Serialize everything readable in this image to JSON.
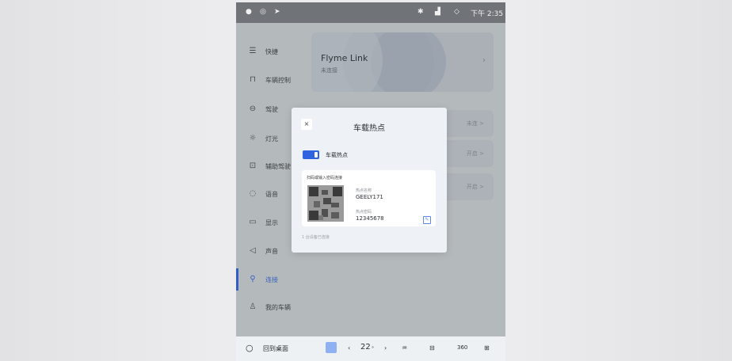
{
  "status_bar": {
    "left_icons": [
      "person-icon",
      "target-icon",
      "location-arrow-icon"
    ],
    "right_icons": [
      "bluetooth-icon",
      "signal-icon",
      "wifi-icon"
    ],
    "time": "下午 2:35"
  },
  "sidebar": {
    "items": [
      {
        "label": "快捷",
        "icon": "menu-icon"
      },
      {
        "label": "车辆控制",
        "icon": "car-icon"
      },
      {
        "label": "驾驶",
        "icon": "steering-wheel-icon"
      },
      {
        "label": "灯光",
        "icon": "light-icon"
      },
      {
        "label": "辅助驾驶",
        "icon": "assist-icon"
      },
      {
        "label": "语音",
        "icon": "voice-icon"
      },
      {
        "label": "显示",
        "icon": "display-icon"
      },
      {
        "label": "声音",
        "icon": "sound-icon"
      },
      {
        "label": "连接",
        "icon": "link-icon",
        "active": true
      },
      {
        "label": "我的车辆",
        "icon": "user-icon"
      }
    ]
  },
  "content": {
    "flyme": {
      "title": "Flyme Link",
      "subtitle": "未连接"
    },
    "rows": [
      {
        "tag": "未连 >"
      },
      {
        "tag": "开启 >"
      },
      {
        "tag": "开启 >"
      }
    ]
  },
  "modal": {
    "close_glyph": "×",
    "title": "车载热点",
    "toggle_label": "车载热点",
    "toggle_on": true,
    "scan_hint": "扫码或输入密码连接",
    "name_label": "热点名称",
    "name_value": "GEELY171",
    "password_label": "热点密码",
    "password_value": "12345678",
    "footer": "1 台设备已连接"
  },
  "dock": {
    "home_label": "回到桌面",
    "temperature": "22",
    "temp_unit": "°",
    "ac_label": "360"
  },
  "colors": {
    "accent": "#2f63e0",
    "screen_bg": "#cfd3d6",
    "modal_bg": "#eef1f6"
  }
}
